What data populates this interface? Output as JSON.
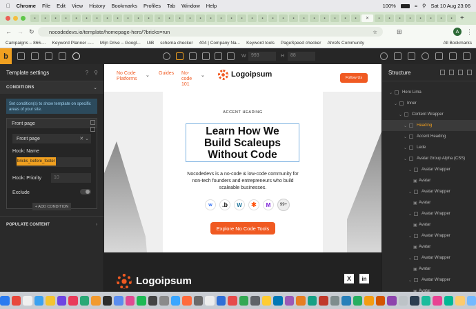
{
  "menubar": {
    "app": "Chrome",
    "items": [
      "File",
      "Edit",
      "View",
      "History",
      "Bookmarks",
      "Profiles",
      "Tab",
      "Window",
      "Help"
    ],
    "battery": "100%",
    "datetime": "Sat 10 Aug  23:06"
  },
  "browser": {
    "url": "nocodedevs.io/template/homepage-hero/?bricks=run",
    "avatar": "A",
    "all_bookmarks": "All Bookmarks",
    "bookmarks": [
      "Campaigns – 866-...",
      "Keyword Planner –...",
      "Mijn Drive – Googl...",
      "UiB",
      "schema checker",
      "404 | Company Na...",
      "Keyword tools",
      "PageSpeed checker",
      "Ahrefs Community"
    ]
  },
  "toolbar": {
    "width": "993",
    "height": "88"
  },
  "left": {
    "title": "Template settings",
    "conditions": "CONDITIONS",
    "note": "Set condition(s) to show template on specific areas of your site.",
    "front_page_1": "Front page",
    "front_page_2": "Front page",
    "hook_name_label": "Hook: Name",
    "hook_name_value": "bricks_before_footer",
    "priority_label": "Hook: Priority",
    "priority_value": "10",
    "exclude_label": "Exclude",
    "add_condition": "+ ADD CONDITION",
    "populate": "POPULATE CONTENT"
  },
  "site": {
    "nav": [
      "No Code Platforms",
      "Guides",
      "No-code 101"
    ],
    "logo": "Logoipsum",
    "follow": "Follow Us",
    "accent": "ACCENT HEADING",
    "heading": "Learn How We Build Scaleups Without Code",
    "lede": "Nocodedevs is a no-code & low-code community for non-tech founders and entrepreneurs who build scaleable businesses.",
    "more": "99+",
    "cta": "Explore No Code Tools",
    "footer_logo": "Logoipsum",
    "tool_icons": [
      "webflow-icon",
      "bubble-icon",
      "wordpress-icon",
      "zapier-icon",
      "make-icon"
    ]
  },
  "structure": {
    "title": "Structure",
    "items": [
      {
        "label": "Hero Lima",
        "indent": 0
      },
      {
        "label": "Inner",
        "indent": 1
      },
      {
        "label": "Content Wrapper",
        "indent": 2
      },
      {
        "label": "Heading",
        "indent": 3,
        "active": true
      },
      {
        "label": "Accent Heading",
        "indent": 3
      },
      {
        "label": "Lede",
        "indent": 3
      },
      {
        "label": "Avatar Group Alpha (CSS)",
        "indent": 3
      },
      {
        "label": "Avatar Wrapper",
        "indent": 4
      },
      {
        "label": "Avatar",
        "indent": 5
      },
      {
        "label": "Avatar Wrapper",
        "indent": 4
      },
      {
        "label": "Avatar",
        "indent": 5
      },
      {
        "label": "Avatar Wrapper",
        "indent": 4
      },
      {
        "label": "Avatar",
        "indent": 5
      },
      {
        "label": "Avatar Wrapper",
        "indent": 4
      },
      {
        "label": "Avatar",
        "indent": 5
      },
      {
        "label": "Avatar Wrapper",
        "indent": 4
      },
      {
        "label": "Avatar",
        "indent": 5
      },
      {
        "label": "Avatar Wrapper",
        "indent": 4
      },
      {
        "label": "Avatar",
        "indent": 5
      }
    ]
  },
  "colors": {
    "accent": "#f0a020",
    "orange": "#f05a22",
    "panel": "#2a2a2a",
    "blue": "#2c4a5c"
  }
}
